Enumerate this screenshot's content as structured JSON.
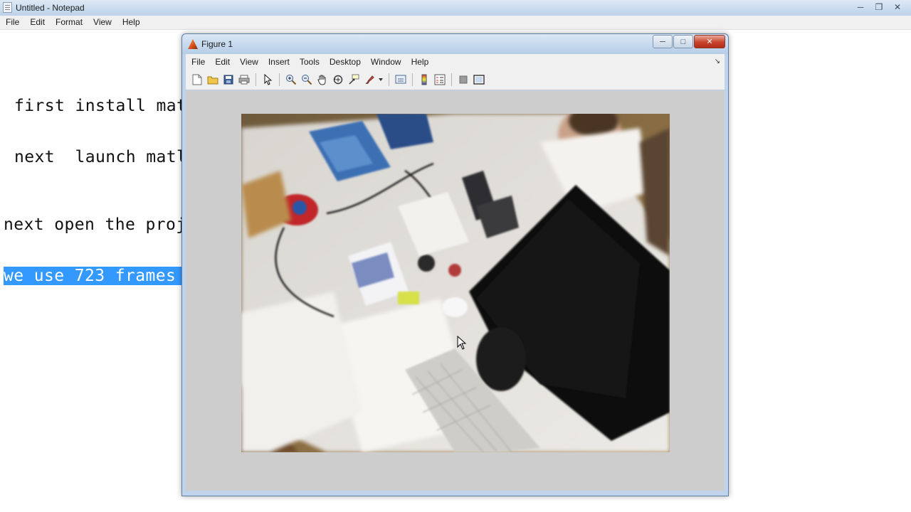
{
  "notepad": {
    "title": "Untitled - Notepad",
    "menu": [
      "File",
      "Edit",
      "Format",
      "View",
      "Help"
    ],
    "lines": [
      "first install mat",
      "next  launch matl",
      "next open the proj",
      "we use 723 frames "
    ],
    "selected_line_index": 3
  },
  "figure": {
    "title": "Figure 1",
    "menu": [
      "File",
      "Edit",
      "View",
      "Insert",
      "Tools",
      "Desktop",
      "Window",
      "Help"
    ],
    "toolbar_icons": [
      "new-figure-icon",
      "open-file-icon",
      "save-icon",
      "print-icon",
      "edit-plot-arrow-icon",
      "zoom-in-icon",
      "zoom-out-icon",
      "pan-hand-icon",
      "rotate-3d-icon",
      "data-cursor-icon",
      "brush-icon",
      "link-plot-icon",
      "colorbar-icon",
      "legend-icon",
      "hide-plot-tools-icon",
      "show-plot-tools-icon"
    ],
    "image_content": "webcam frame of a cluttered office desk with keyboard, monitor and person"
  },
  "colors": {
    "selection": "#3399ff",
    "window_frame": "#bfd4ea",
    "close_button": "#c7432c",
    "canvas": "#cdcdcd"
  }
}
